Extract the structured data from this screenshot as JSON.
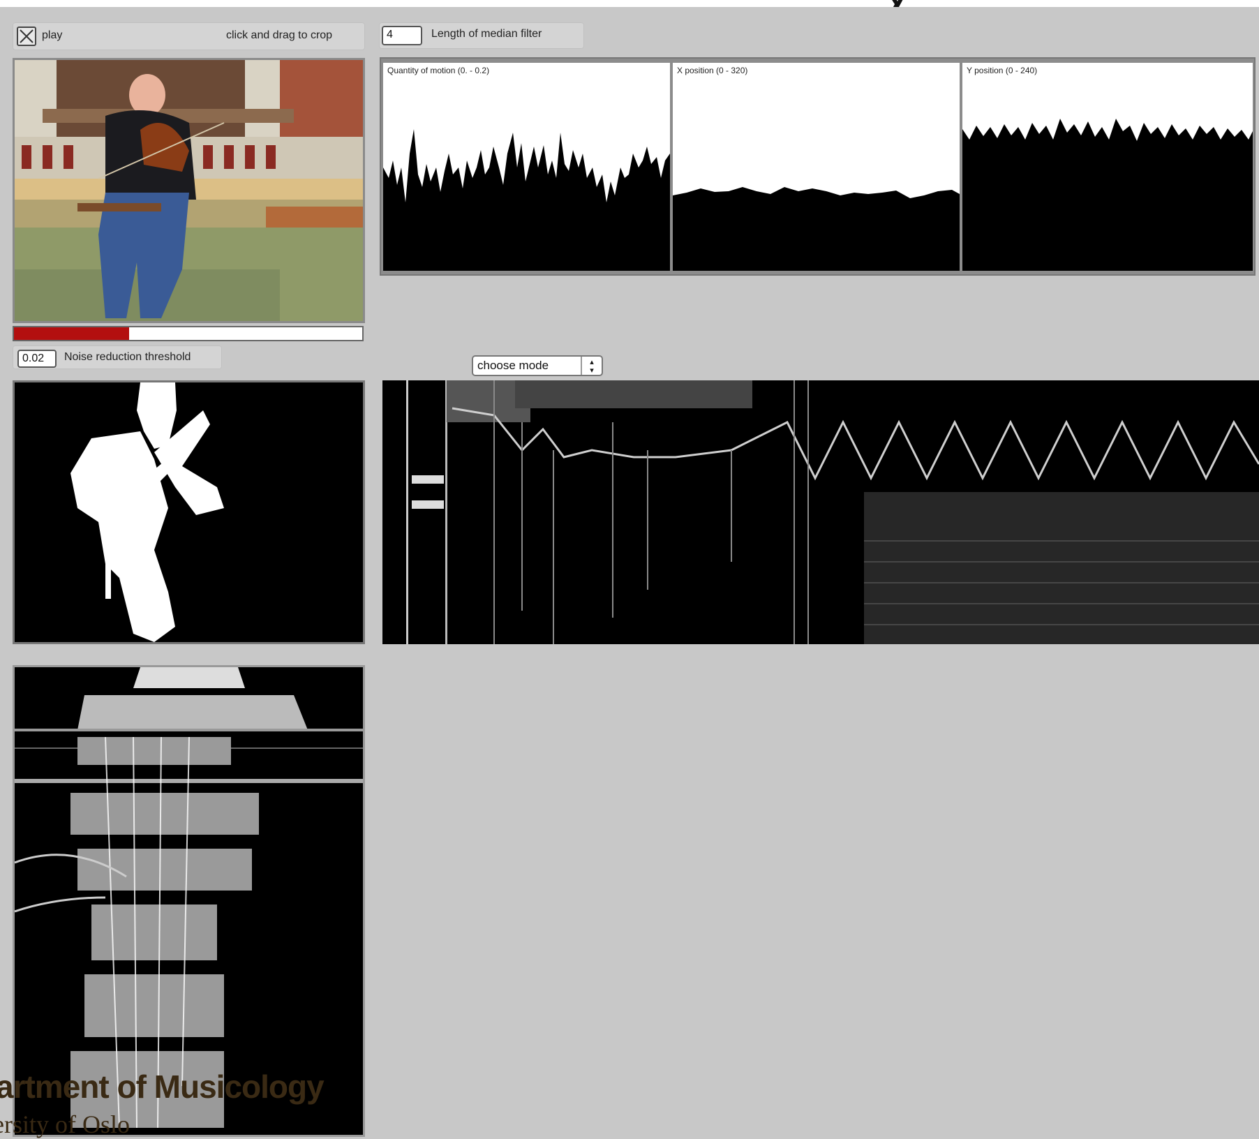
{
  "controls": {
    "play_label": "play",
    "crop_hint": "click and drag to crop",
    "median_filter_value": "4",
    "median_filter_label": "Length of median filter",
    "noise_threshold_value": "0.02",
    "noise_threshold_label": "Noise reduction threshold",
    "mode_select_value": "choose mode"
  },
  "playback": {
    "progress": 0.33
  },
  "plots": [
    {
      "title": "Quantity of motion (0. - 0.2)"
    },
    {
      "title": "X position (0 - 320)"
    },
    {
      "title": "Y position (0 - 240)"
    }
  ],
  "footer": {
    "title": "artment of Musicology",
    "subtitle": "ersity of Oslo"
  },
  "colors": {
    "background": "#c8c8c8",
    "progress_fill": "#b30f0f",
    "footer_text": "#3a2a14"
  },
  "icons": {
    "play_checkbox": "x-mark-icon",
    "select_arrows": "up-down-arrows-icon"
  }
}
